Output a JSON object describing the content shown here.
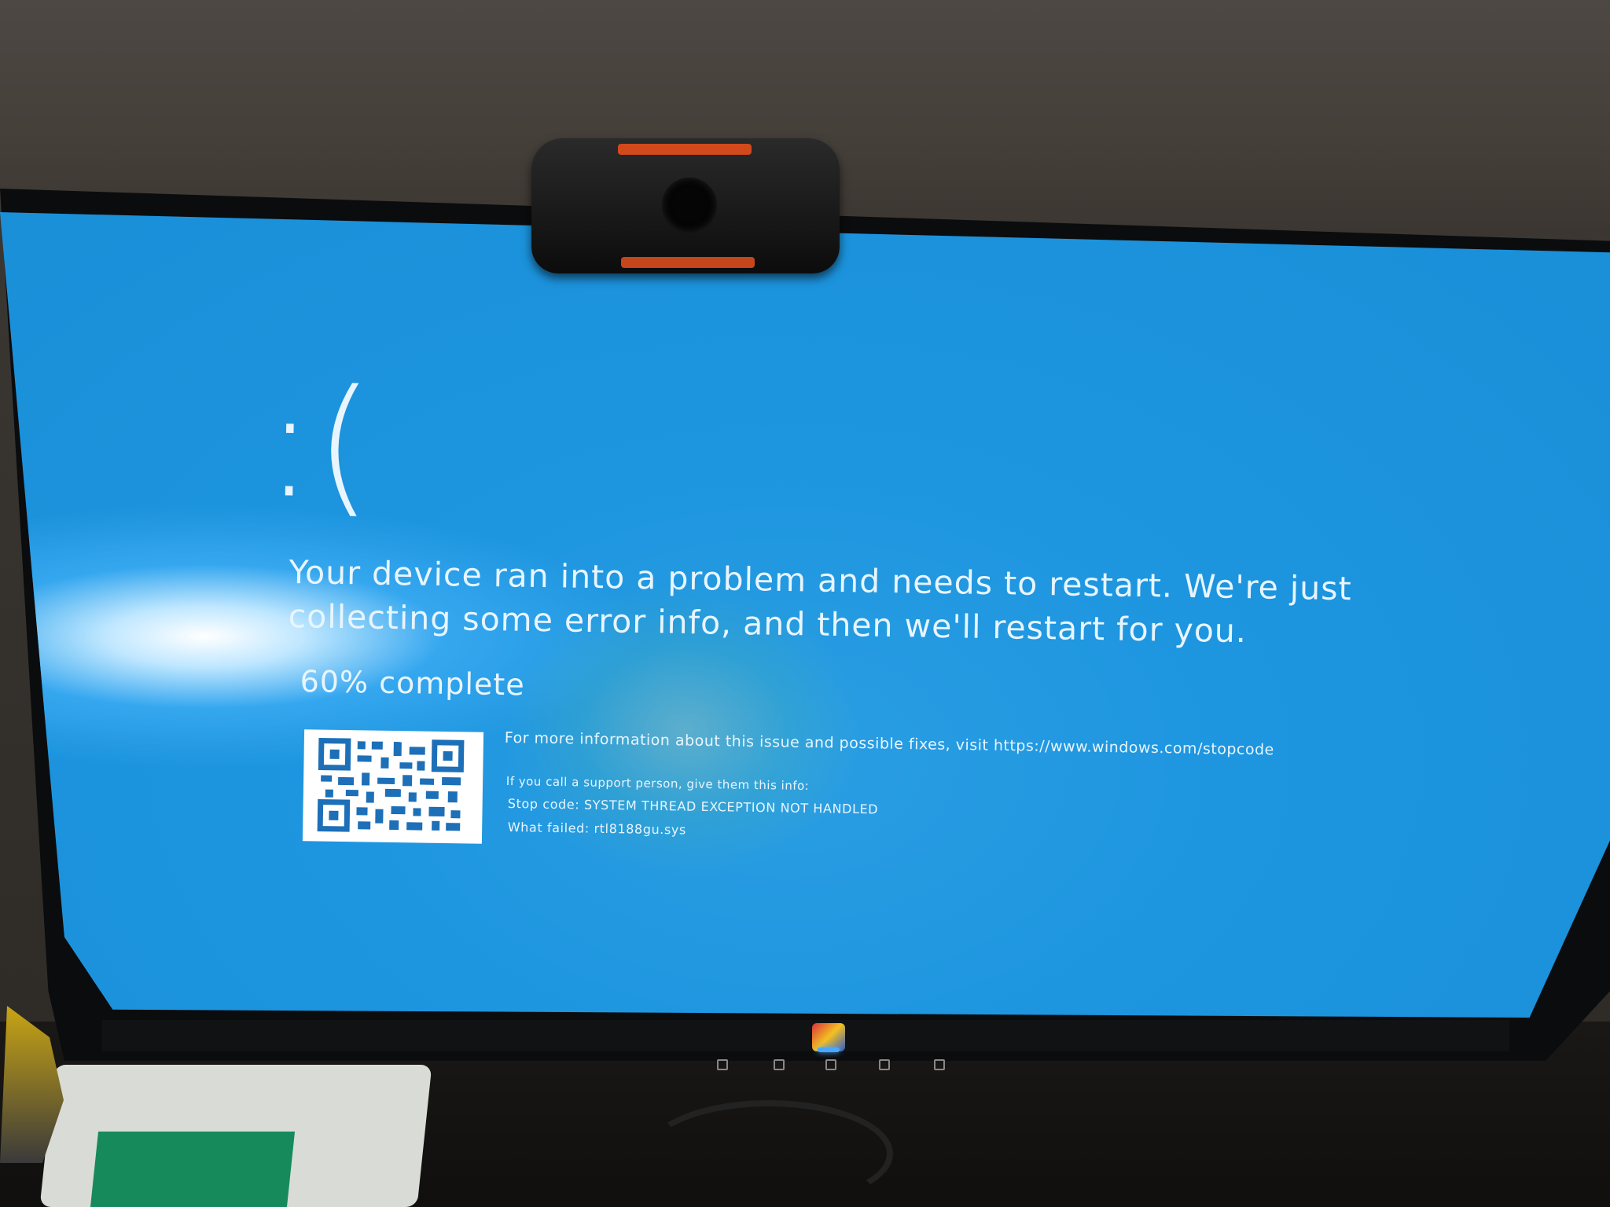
{
  "bsod": {
    "face": ":(",
    "message": "Your device ran into a problem and needs to restart. We're just collecting some error info, and then we'll restart for you.",
    "progress": {
      "percent": 60,
      "label": "60% complete"
    },
    "more_info": "For more information about this issue and possible fixes, visit https://www.windows.com/stopcode",
    "support_line": "If you call a support person, give them this info:",
    "stop_code": "Stop code: SYSTEM THREAD EXCEPTION NOT HANDLED",
    "what_failed": "What failed: rtl8188gu.sys"
  },
  "colors": {
    "screen_blue": "#1d95df",
    "text": "#e8f5ff",
    "webcam_accent": "#d24a1c",
    "power_led": "#4aa7ff"
  },
  "icons": {
    "qr": "qr-code-icon",
    "bezel_star": "star-icon",
    "bezel_power": "power-icon"
  }
}
